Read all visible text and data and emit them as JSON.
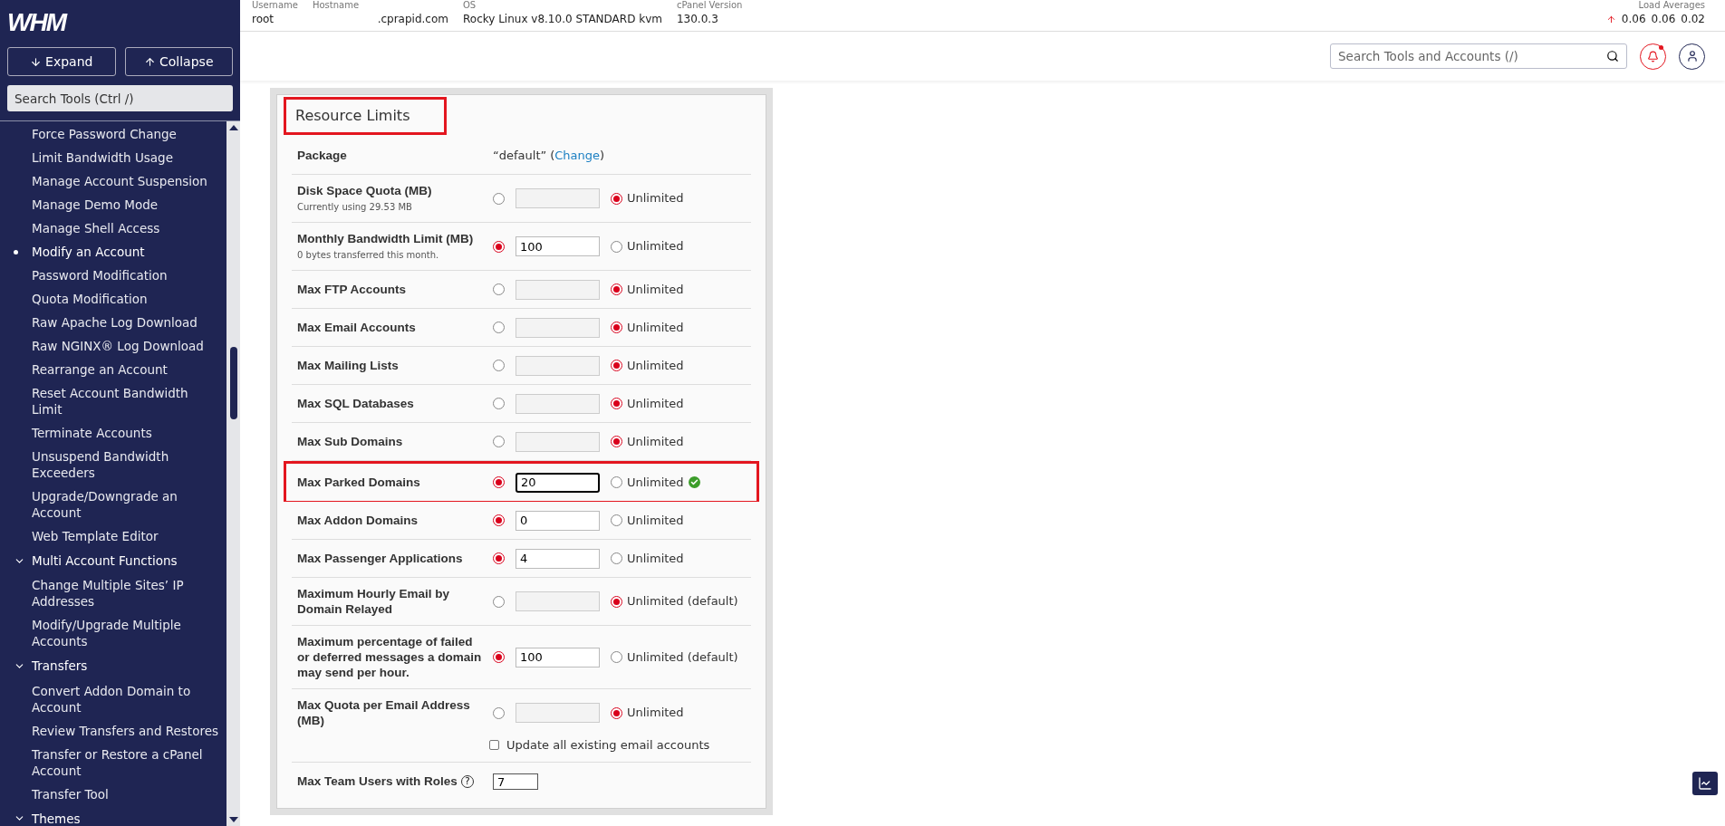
{
  "sidebar": {
    "logo": "WHM",
    "expand_button": "Expand",
    "collapse_button": "Collapse",
    "search": {
      "placeholder": "Search Tools (Ctrl /)"
    },
    "groups": [
      {
        "items": [
          {
            "label": "Force Password Change",
            "selected": false
          },
          {
            "label": "Limit Bandwidth Usage",
            "selected": false
          },
          {
            "label": "Manage Account Suspension",
            "selected": false
          },
          {
            "label": "Manage Demo Mode",
            "selected": false
          },
          {
            "label": "Manage Shell Access",
            "selected": false
          },
          {
            "label": "Modify an Account",
            "selected": true
          },
          {
            "label": "Password Modification",
            "selected": false
          },
          {
            "label": "Quota Modification",
            "selected": false
          },
          {
            "label": "Raw Apache Log Download",
            "selected": false
          },
          {
            "label": "Raw NGINX® Log Download",
            "selected": false
          },
          {
            "label": "Rearrange an Account",
            "selected": false
          },
          {
            "label": "Reset Account Bandwidth Limit",
            "selected": false
          },
          {
            "label": "Terminate Accounts",
            "selected": false
          },
          {
            "label": "Unsuspend Bandwidth Exceeders",
            "selected": false
          },
          {
            "label": "Upgrade/Downgrade an Account",
            "selected": false
          },
          {
            "label": "Web Template Editor",
            "selected": false
          }
        ]
      },
      {
        "title": "Multi Account Functions",
        "expanded": true,
        "items": [
          {
            "label": "Change Multiple Sites’ IP Addresses",
            "selected": false
          },
          {
            "label": "Modify/Upgrade Multiple Accounts",
            "selected": false
          }
        ]
      },
      {
        "title": "Transfers",
        "expanded": true,
        "items": [
          {
            "label": "Convert Addon Domain to Account",
            "selected": false
          },
          {
            "label": "Review Transfers and Restores",
            "selected": false
          },
          {
            "label": "Transfer or Restore a cPanel Account",
            "selected": false
          },
          {
            "label": "Transfer Tool",
            "selected": false
          }
        ]
      },
      {
        "title": "Themes",
        "expanded": true
      }
    ]
  },
  "info_bar": {
    "fields": [
      {
        "label": "Username",
        "value": "root"
      },
      {
        "label": "Hostname",
        "value": ".cprapid.com"
      },
      {
        "label": "OS",
        "value": "Rocky Linux v8.10.0 STANDARD kvm"
      },
      {
        "label": "cPanel Version",
        "value": "130.0.3"
      }
    ],
    "load_averages": {
      "label": "Load Averages",
      "values": [
        "0.06",
        "0.06",
        "0.02"
      ]
    }
  },
  "top_bar": {
    "search": {
      "placeholder": "Search Tools and Accounts (/)"
    },
    "notifications": {
      "unread": true
    }
  },
  "panel": {
    "title": "Resource Limits",
    "title_highlighted": true,
    "rows": [
      {
        "kind": "package",
        "label": "Package",
        "value": "“default”",
        "paren_open": "(",
        "link": "Change",
        "paren_close": ")",
        "highlighted": false
      },
      {
        "kind": "limit",
        "label": "Disk Space Quota (MB)",
        "note": "Currently using 29.53 MB",
        "unlimited_selected": true,
        "unlimited_label": "Unlimited",
        "highlighted": false
      },
      {
        "kind": "limit",
        "label": "Monthly Bandwidth Limit (MB)",
        "note": "0 bytes transferred this month.",
        "unlimited_selected": false,
        "value": "100",
        "unlimited_label": "Unlimited",
        "highlighted": false
      },
      {
        "kind": "limit",
        "label": "Max FTP Accounts",
        "unlimited_selected": true,
        "unlimited_label": "Unlimited",
        "highlighted": false
      },
      {
        "kind": "limit",
        "label": "Max Email Accounts",
        "unlimited_selected": true,
        "unlimited_label": "Unlimited",
        "highlighted": false
      },
      {
        "kind": "limit",
        "label": "Max Mailing Lists",
        "unlimited_selected": true,
        "unlimited_label": "Unlimited",
        "highlighted": false
      },
      {
        "kind": "limit",
        "label": "Max SQL Databases",
        "unlimited_selected": true,
        "unlimited_label": "Unlimited",
        "highlighted": false
      },
      {
        "kind": "limit",
        "label": "Max Sub Domains",
        "unlimited_selected": true,
        "unlimited_label": "Unlimited",
        "highlighted": false
      },
      {
        "kind": "limit",
        "label": "Max Parked Domains",
        "unlimited_selected": false,
        "value": "20",
        "focused": true,
        "valid": true,
        "unlimited_label": "Unlimited",
        "highlighted": true
      },
      {
        "kind": "limit",
        "label": "Max Addon Domains",
        "unlimited_selected": false,
        "value": "0",
        "unlimited_label": "Unlimited",
        "highlighted": false
      },
      {
        "kind": "limit",
        "label": "Max Passenger Applications",
        "unlimited_selected": false,
        "value": "4",
        "unlimited_label": "Unlimited",
        "highlighted": false
      },
      {
        "kind": "limit",
        "label": "Maximum Hourly Email by Domain Relayed",
        "unlimited_selected": true,
        "unlimited_label": "Unlimited (default)",
        "highlighted": false
      },
      {
        "kind": "limit",
        "label": "Maximum percentage of failed or deferred messages a domain may send per hour.",
        "unlimited_selected": false,
        "value": "100",
        "unlimited_label": "Unlimited (default)",
        "highlighted": false
      },
      {
        "kind": "limit",
        "label": "Max Quota per Email Address (MB)",
        "unlimited_selected": true,
        "unlimited_label": "Unlimited",
        "highlighted": false,
        "checkbox": {
          "label": "Update all existing email accounts",
          "checked": false
        }
      },
      {
        "kind": "number",
        "label": "Max Team Users with Roles",
        "help": "?",
        "value": "7",
        "highlighted": false
      }
    ]
  }
}
